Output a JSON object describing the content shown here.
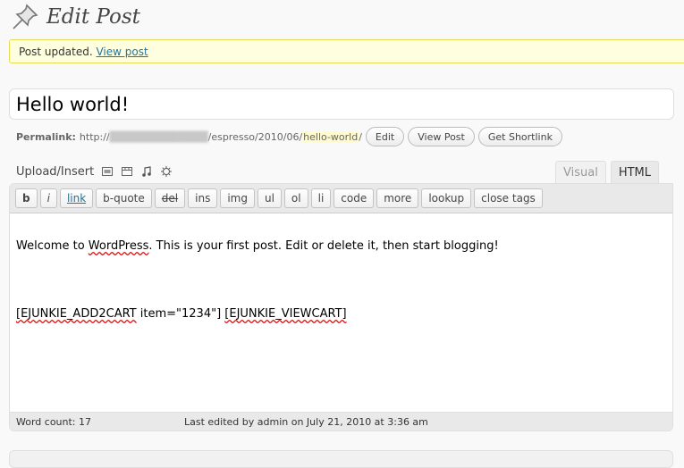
{
  "header": {
    "title": "Edit Post",
    "icon": "pushpin-icon"
  },
  "notice": {
    "text": "Post updated.",
    "link": "View post"
  },
  "post": {
    "title": "Hello world!"
  },
  "permalink": {
    "label": "Permalink:",
    "prefix": "http://",
    "blurred_domain": "█████████████",
    "path": "/espresso/2010/06/",
    "slug": "hello-world",
    "suffix": "/",
    "buttons": {
      "edit": "Edit",
      "view": "View Post",
      "shortlink": "Get Shortlink"
    }
  },
  "upload": {
    "label": "Upload/Insert"
  },
  "tabs": {
    "visual": "Visual",
    "html": "HTML"
  },
  "quicktags": {
    "b": "b",
    "i": "i",
    "link": "link",
    "bquote": "b-quote",
    "del": "del",
    "ins": "ins",
    "img": "img",
    "ul": "ul",
    "ol": "ol",
    "li": "li",
    "code": "code",
    "more": "more",
    "lookup": "lookup",
    "close": "close tags"
  },
  "content": {
    "line1_pre": "Welcome to ",
    "line1_word": "WordPress",
    "line1_post": ". This is your first post. Edit or delete it, then start blogging!",
    "line2_a": "[EJUNKIE_ADD2CART",
    "line2_b": " item=\"1234\"] ",
    "line2_c": "[EJUNKIE_VIEWCART]"
  },
  "status": {
    "word_count": "Word count: 17",
    "last_edited": "Last edited by admin on July 21, 2010 at 3:36 am"
  },
  "colors": {
    "link": "#21759b",
    "notice_bg": "#ffffe0",
    "notice_border": "#e6db55"
  }
}
